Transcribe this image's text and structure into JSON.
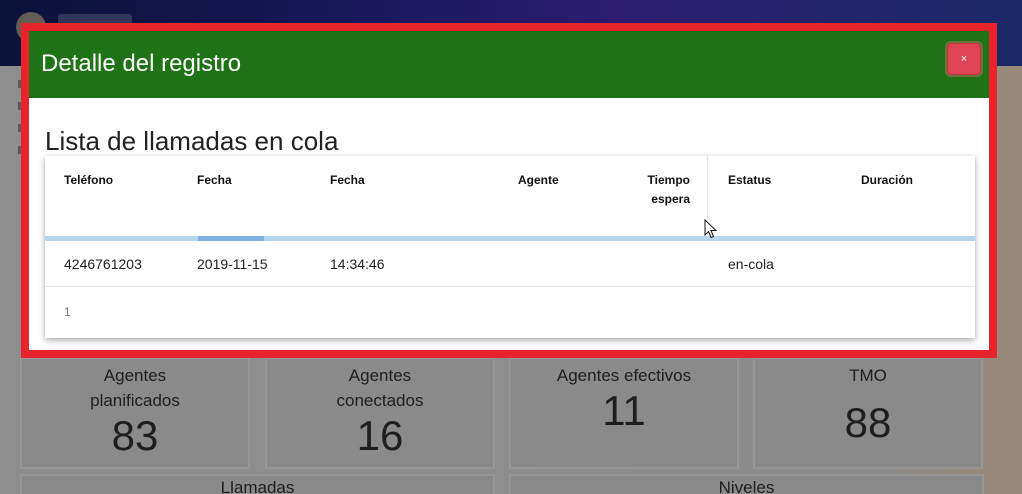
{
  "modal": {
    "title": "Detalle del registro",
    "close_label": "×",
    "list_title": "Lista de llamadas en cola",
    "table": {
      "headers": {
        "telefono": "Teléfono",
        "fecha": "Fecha",
        "hora": "Fecha",
        "agente": "Agente",
        "tiempo_espera_1": "Tiempo",
        "tiempo_espera_2": "espera",
        "estatus": "Estatus",
        "duracion": "Duración"
      },
      "rows": [
        {
          "telefono": "4246761203",
          "fecha": "2019-11-15",
          "hora": "14:34:46",
          "agente": "",
          "tiempo_espera": "",
          "estatus": "en-cola",
          "duracion": ""
        }
      ],
      "pagination": {
        "current_page": "1"
      }
    }
  },
  "dashboard": {
    "cards": [
      {
        "label": "Agentes planificados",
        "value": "83"
      },
      {
        "label": "Agentes conectados",
        "value": "16"
      },
      {
        "label": "Agentes efectivos",
        "value": "11"
      },
      {
        "label": "TMO",
        "value": "88"
      }
    ],
    "bottom_cards": [
      {
        "label": "Llamadas"
      },
      {
        "label": "Niveles"
      }
    ]
  },
  "colors": {
    "modal_header": "#207217",
    "modal_frame": "#e8232b",
    "close_button": "#e04555",
    "progress": "#b8d5ef"
  },
  "icons": {
    "close": "close-icon",
    "cursor": "mouse-pointer-icon"
  }
}
